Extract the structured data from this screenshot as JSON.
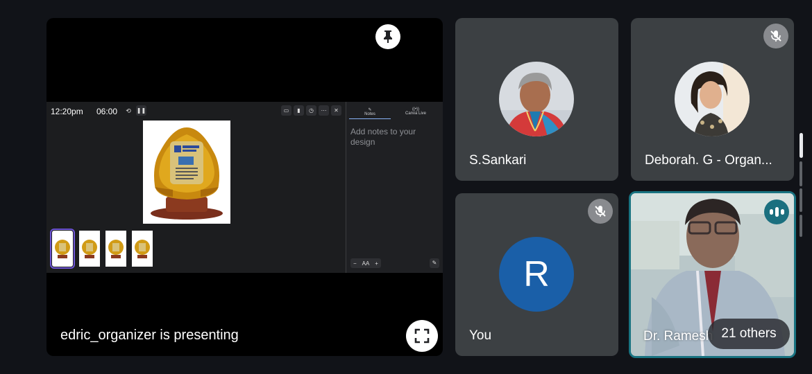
{
  "presentation": {
    "presenter_label": "edric_organizer is presenting",
    "pin_icon": "pin-icon",
    "fullscreen_icon": "fullscreen-icon",
    "screen": {
      "clock": "12:20pm",
      "timer": "06:00",
      "notes_tab": "Notes",
      "canva_live_tab": "Canva Live",
      "notes_placeholder": "Add notes to your design",
      "zoom_minus": "−",
      "zoom_label": "AA",
      "zoom_plus": "+",
      "slide_count": 4
    }
  },
  "participants": [
    {
      "name": "S.Sankari",
      "muted": false
    },
    {
      "name": "Deborah. G - Organ...",
      "muted": true
    },
    {
      "name": "You",
      "initial": "R",
      "muted": true,
      "avatar_color": "#1a5fa8"
    },
    {
      "name": "Dr. Ramesh",
      "speaking": true
    }
  ],
  "others": {
    "label": "21 others"
  },
  "colors": {
    "background": "#111318",
    "tile": "#3c4043",
    "speaking_border": "#197381",
    "selected_thumb": "#6e55d6"
  }
}
